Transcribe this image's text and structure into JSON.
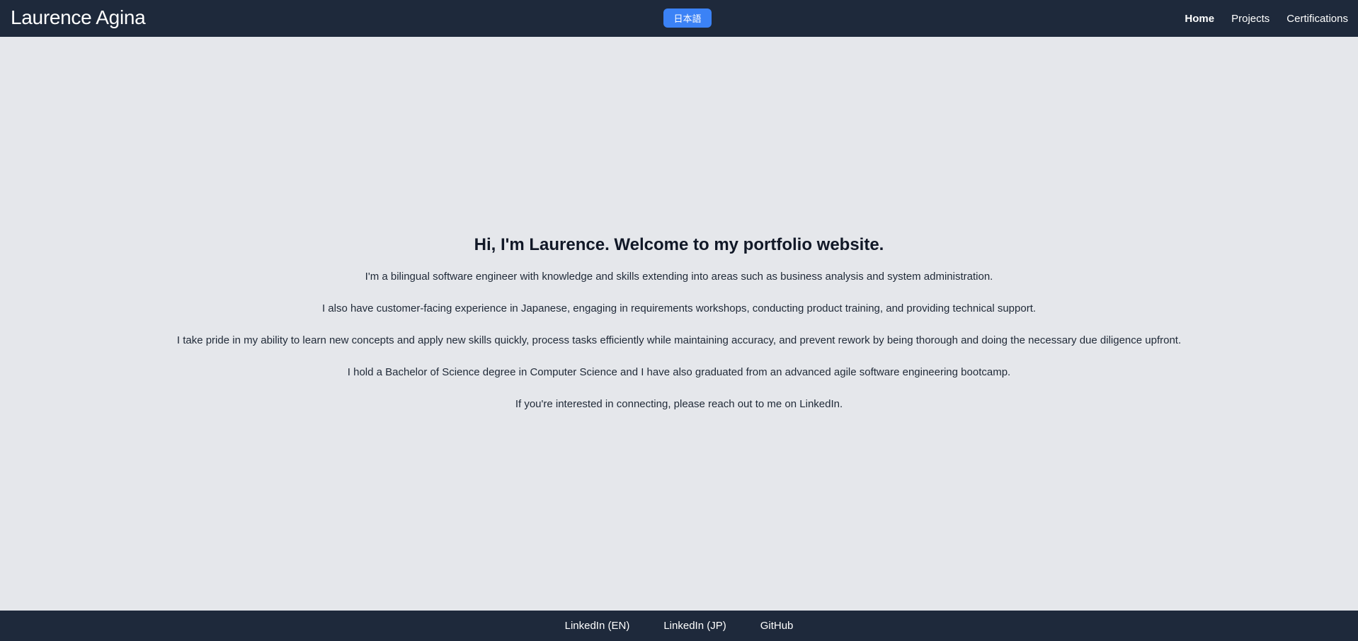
{
  "header": {
    "brand": "Laurence Agina",
    "language_button": "日本語",
    "nav": [
      {
        "label": "Home",
        "active": true
      },
      {
        "label": "Projects",
        "active": false
      },
      {
        "label": "Certifications",
        "active": false
      }
    ]
  },
  "main": {
    "heading": "Hi, I'm Laurence. Welcome to my portfolio website.",
    "paragraphs": [
      "I'm a bilingual software engineer with knowledge and skills extending into areas such as business analysis and system administration.",
      "I also have customer-facing experience in Japanese, engaging in requirements workshops, conducting product training, and providing technical support.",
      "I take pride in my ability to learn new concepts and apply new skills quickly, process tasks efficiently while maintaining accuracy, and prevent rework by being thorough and doing the necessary due diligence upfront.",
      "I hold a Bachelor of Science degree in Computer Science and I have also graduated from an advanced agile software engineering bootcamp.",
      "If you're interested in connecting, please reach out to me on LinkedIn."
    ]
  },
  "footer": {
    "links": [
      "LinkedIn (EN)",
      "LinkedIn (JP)",
      "GitHub"
    ]
  },
  "colors": {
    "navbar_bg": "#1e293b",
    "page_bg": "#e5e7eb",
    "accent": "#3b82f6"
  }
}
